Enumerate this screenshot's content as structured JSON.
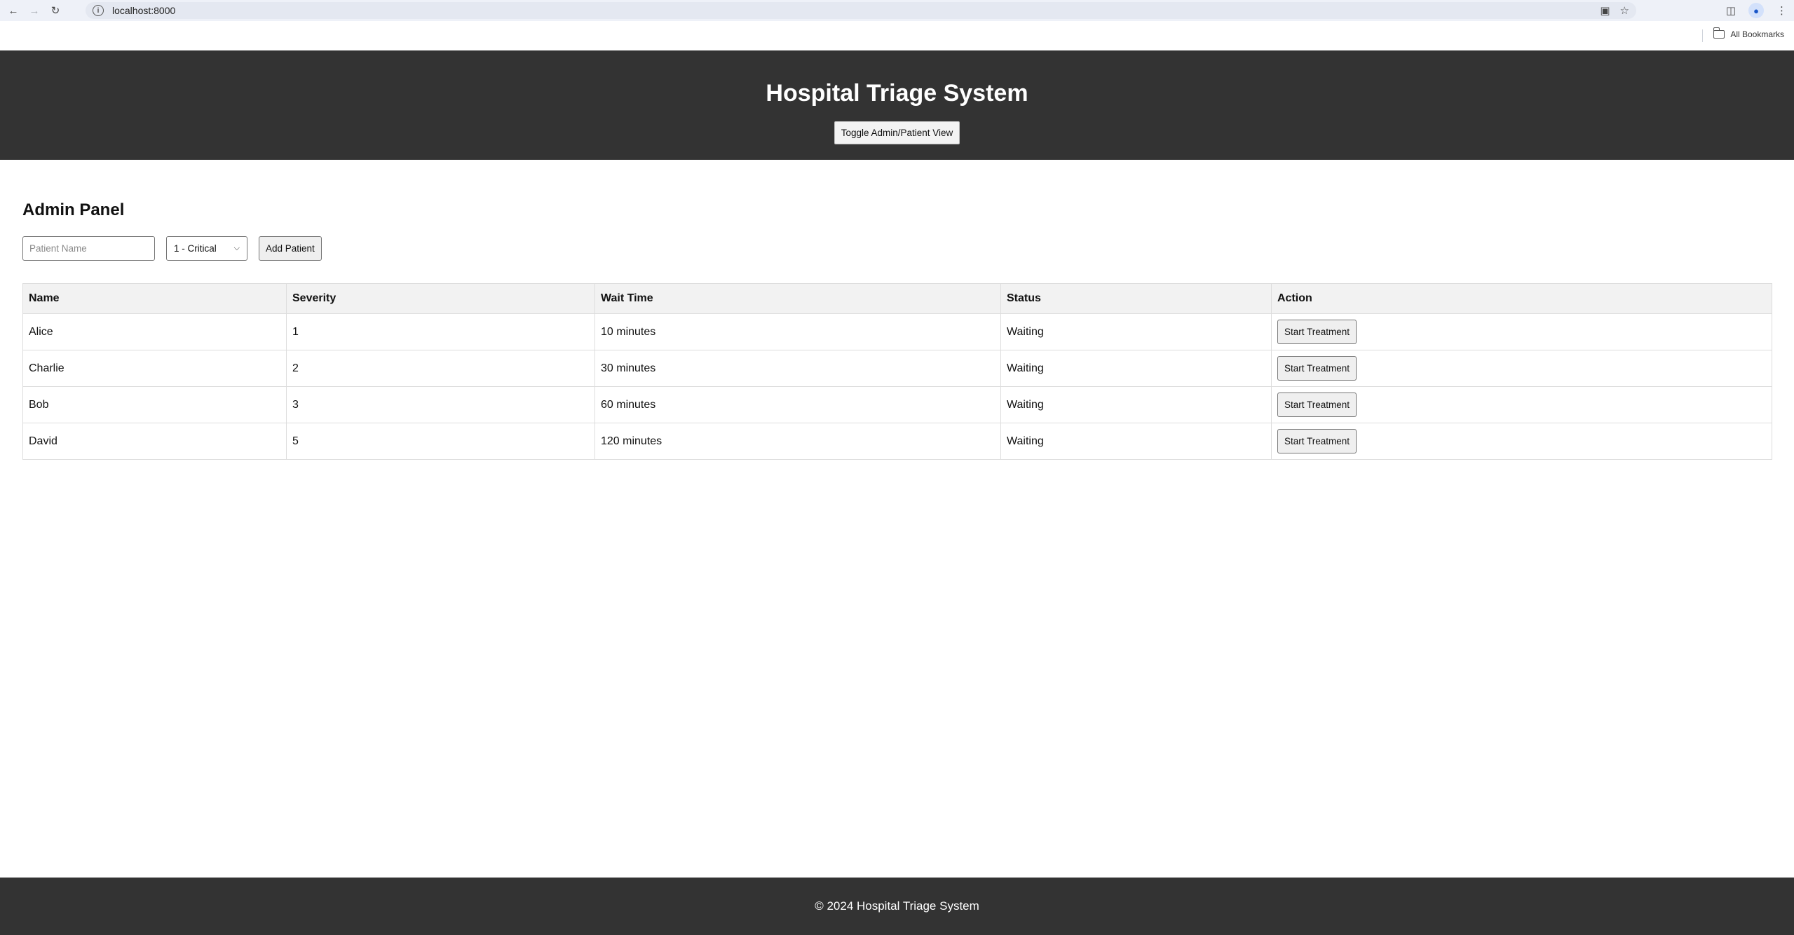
{
  "browser": {
    "url": "localhost:8000",
    "bookmarks_label": "All Bookmarks"
  },
  "header": {
    "title": "Hospital Triage System",
    "toggle_label": "Toggle Admin/Patient View"
  },
  "admin": {
    "panel_title": "Admin Panel",
    "name_placeholder": "Patient Name",
    "severity_selected": "1 - Critical",
    "add_label": "Add Patient"
  },
  "table": {
    "headers": [
      "Name",
      "Severity",
      "Wait Time",
      "Status",
      "Action"
    ],
    "rows": [
      {
        "name": "Alice",
        "severity": "1",
        "wait": "10 minutes",
        "status": "Waiting",
        "action": "Start Treatment"
      },
      {
        "name": "Charlie",
        "severity": "2",
        "wait": "30 minutes",
        "status": "Waiting",
        "action": "Start Treatment"
      },
      {
        "name": "Bob",
        "severity": "3",
        "wait": "60 minutes",
        "status": "Waiting",
        "action": "Start Treatment"
      },
      {
        "name": "David",
        "severity": "5",
        "wait": "120 minutes",
        "status": "Waiting",
        "action": "Start Treatment"
      }
    ]
  },
  "footer": {
    "text": "© 2024 Hospital Triage System"
  },
  "icons": {
    "back": "arrow-left-icon",
    "forward": "arrow-right-icon",
    "reload": "reload-icon",
    "site_info": "info-icon",
    "screenshot": "camera-icon",
    "bookmark": "star-icon",
    "extensions": "puzzle-icon",
    "profile": "person-icon",
    "menu": "kebab-menu-icon",
    "bookmarks_folder": "folder-icon"
  },
  "colors": {
    "header_bg": "#333333",
    "footer_bg": "#333333",
    "table_header_bg": "#f2f2f2"
  }
}
